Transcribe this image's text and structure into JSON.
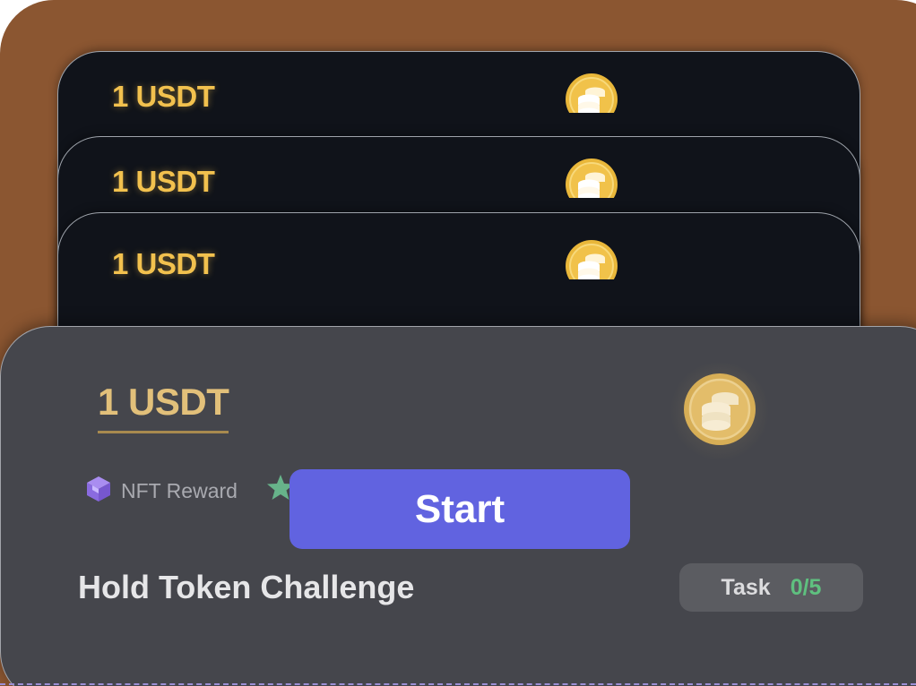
{
  "stacked_cards": [
    {
      "amount": "1 USDT"
    },
    {
      "amount": "1 USDT"
    },
    {
      "amount": "1 USDT"
    }
  ],
  "front_card": {
    "amount": "1 USDT",
    "reward_label": "NFT Reward",
    "start_label": "Start",
    "title": "Hold Token Challenge",
    "task_label": "Task",
    "task_count": "0/5"
  },
  "icons": {
    "coin": "coin-stack-icon",
    "reward": "cube-icon",
    "star": "star-icon"
  },
  "colors": {
    "backdrop": "#8b5631",
    "stack_card_bg": "#10131a",
    "front_card_bg": "#45464c",
    "amount_gold": "#f2c14e",
    "button_bg": "#6163e0",
    "task_accent": "#5fc07f"
  }
}
